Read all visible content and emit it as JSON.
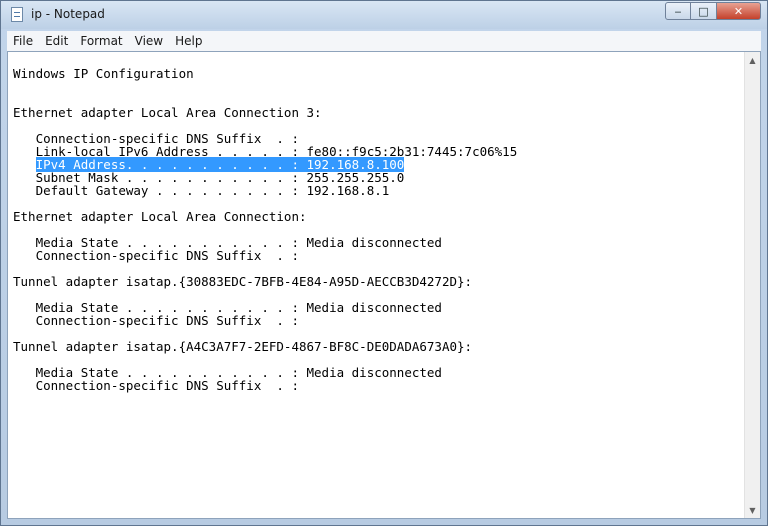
{
  "window": {
    "title": "ip - Notepad",
    "controls": {
      "minimize": "‒",
      "maximize": "□",
      "close": "✕"
    }
  },
  "menu": [
    "File",
    "Edit",
    "Format",
    "View",
    "Help"
  ],
  "document": {
    "lines": [
      {
        "text": "Windows IP Configuration"
      },
      {
        "text": "Ethernet adapter Local Area Connection 3:"
      },
      {
        "text": "   Connection-specific DNS Suffix  . :"
      },
      {
        "text": "   Link-local IPv6 Address . . . . . : fe80::f9c5:2b31:7445:7c06%15"
      },
      {
        "pre": "   ",
        "sel": "IPv4 Address. . . . . . . . . . . : 192.168.8.100"
      },
      {
        "text": "   Subnet Mask . . . . . . . . . . . : 255.255.255.0"
      },
      {
        "text": "   Default Gateway . . . . . . . . . : 192.168.8.1"
      },
      {
        "text": "Ethernet adapter Local Area Connection:"
      },
      {
        "text": "   Media State . . . . . . . . . . . : Media disconnected"
      },
      {
        "text": "   Connection-specific DNS Suffix  . :"
      },
      {
        "text": "Tunnel adapter isatap.{30883EDC-7BFB-4E84-A95D-AECCB3D4272D}:"
      },
      {
        "text": "   Media State . . . . . . . . . . . : Media disconnected"
      },
      {
        "text": "   Connection-specific DNS Suffix  . :"
      },
      {
        "text": "Tunnel adapter isatap.{A4C3A7F7-2EFD-4867-BF8C-DE0DADA673A0}:"
      },
      {
        "text": "   Media State . . . . . . . . . . . : Media disconnected"
      },
      {
        "text": "   Connection-specific DNS Suffix  . :"
      }
    ]
  },
  "colors": {
    "selection": "#3399ff",
    "selection_text": "#ffffff"
  }
}
